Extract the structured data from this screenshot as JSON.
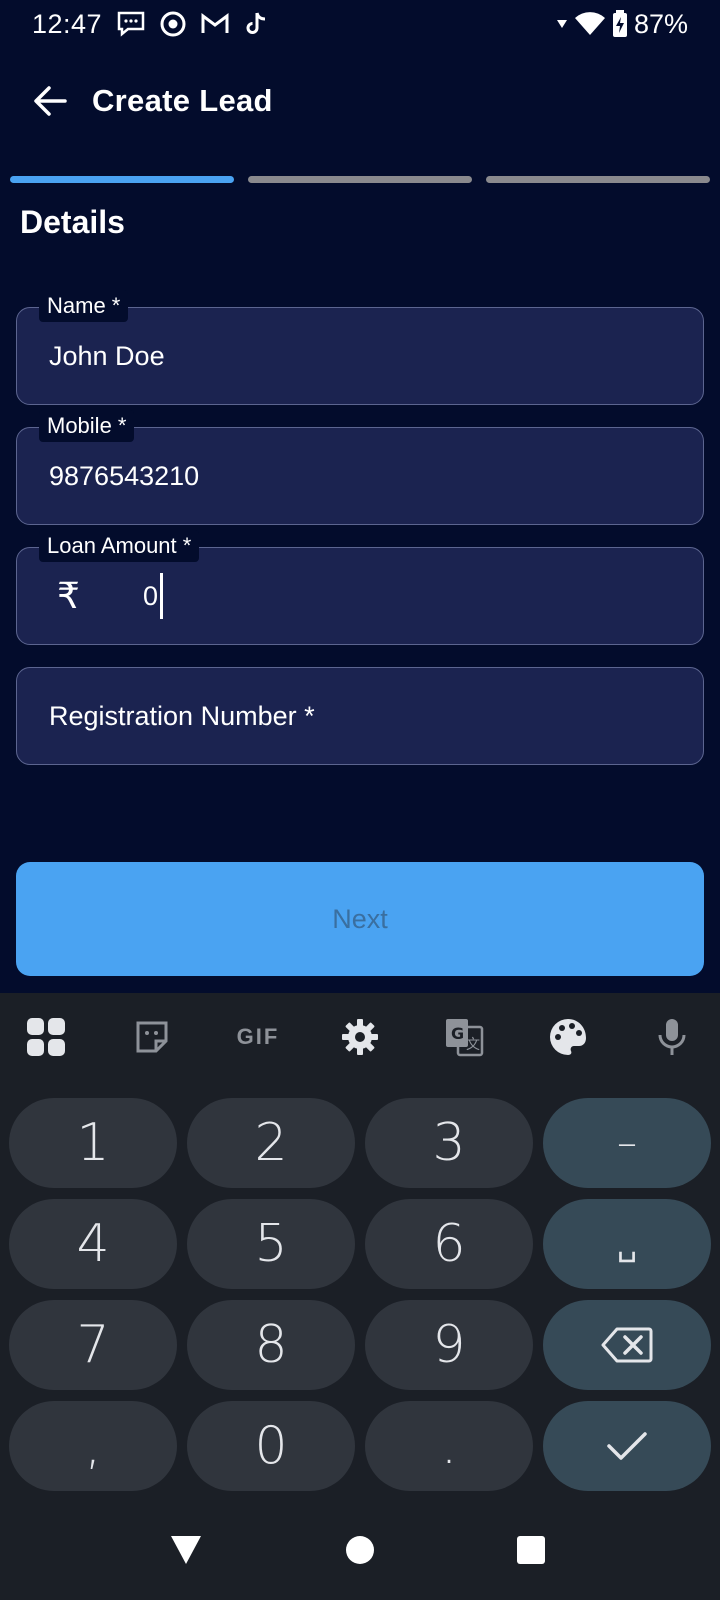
{
  "status_bar": {
    "time": "12:47",
    "battery": "87%",
    "icons_left": [
      "chat-icon",
      "chrome-icon",
      "gmail-icon",
      "tiktok-icon"
    ],
    "icons_right": [
      "signal-icon",
      "wifi-icon",
      "battery-charging-icon"
    ]
  },
  "app_bar": {
    "title": "Create Lead",
    "back_icon": "arrow-left-icon"
  },
  "stepper": {
    "steps": 3,
    "current": 1
  },
  "section": {
    "title": "Details"
  },
  "form": {
    "name": {
      "label": "Name *",
      "value": "John Doe"
    },
    "mobile": {
      "label": "Mobile *",
      "value": "9876543210"
    },
    "loan_amount": {
      "label": "Loan Amount *",
      "currency": "₹",
      "value": "0"
    },
    "registration": {
      "placeholder": "Registration Number *"
    }
  },
  "next_button": {
    "label": "Next"
  },
  "keyboard": {
    "toolbar": [
      "apps-icon",
      "sticker-icon",
      "gif-icon",
      "settings-icon",
      "translate-icon",
      "palette-icon",
      "mic-icon"
    ],
    "gif_label": "GIF",
    "rows": [
      [
        "1",
        "2",
        "3",
        "–"
      ],
      [
        "4",
        "5",
        "6",
        "␣"
      ],
      [
        "7",
        "8",
        "9",
        "⌫"
      ],
      [
        ",",
        "0",
        ".",
        "✓"
      ]
    ]
  },
  "colors": {
    "background": "#030c2c",
    "field_bg": "#1b2350",
    "accent": "#4aa3f2",
    "keyboard_bg": "#1b1f26",
    "key_bg": "#30353d",
    "func_key_bg": "#364a57"
  }
}
